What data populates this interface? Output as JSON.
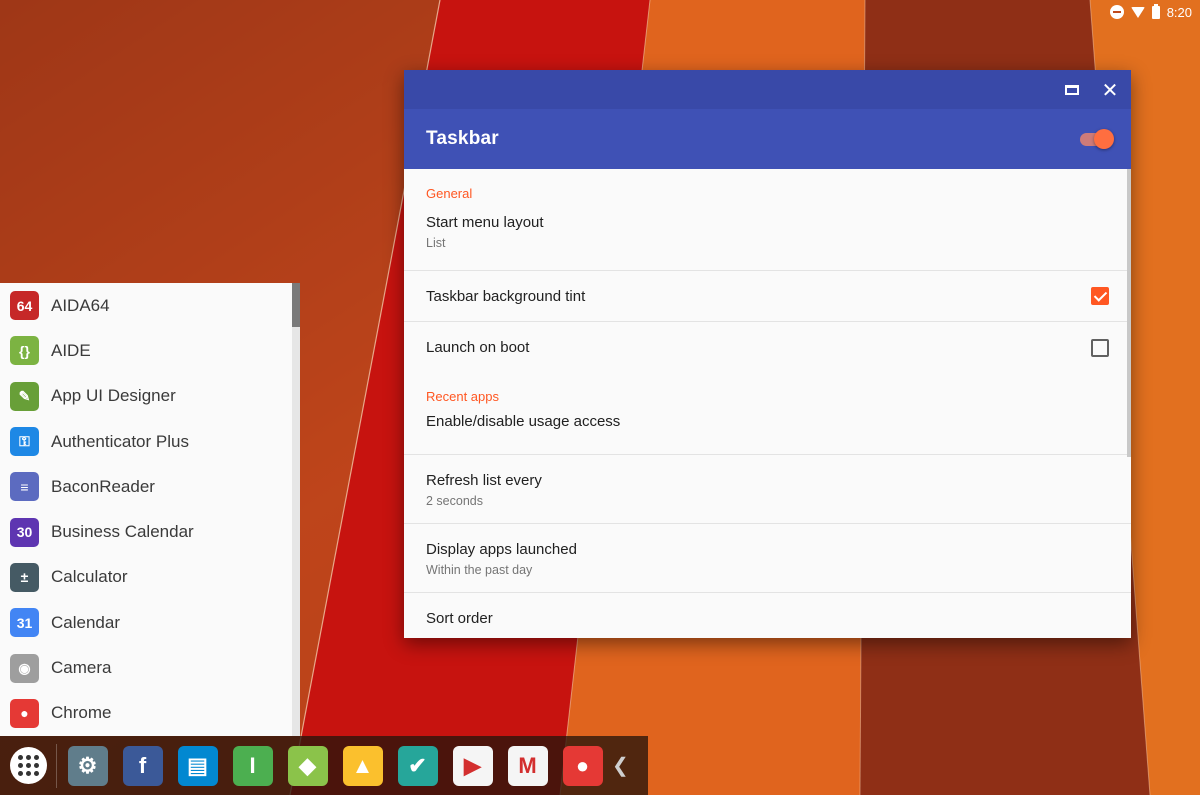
{
  "status_bar": {
    "time": "8:20",
    "icons": [
      "do-not-disturb-icon",
      "wifi-icon",
      "battery-icon"
    ]
  },
  "window": {
    "controls": [
      "restore-icon",
      "close-icon"
    ],
    "app_title": "Taskbar",
    "master_switch_on": true,
    "accent_color": "#ff5722",
    "header_color": "#3f51b5",
    "sections": {
      "general": {
        "header": "General",
        "start_menu_layout": {
          "title": "Start menu layout",
          "summary": "List"
        },
        "background_tint": {
          "title": "Taskbar background tint",
          "checked": true
        },
        "launch_on_boot": {
          "title": "Launch on boot",
          "checked": false
        }
      },
      "recent": {
        "header": "Recent apps",
        "usage_access": {
          "title": "Enable/disable usage access"
        },
        "refresh": {
          "title": "Refresh list every",
          "summary": "2 seconds"
        },
        "display_launched": {
          "title": "Display apps launched",
          "summary": "Within the past day"
        },
        "sort_order": {
          "title": "Sort order"
        }
      }
    }
  },
  "start_menu": {
    "apps": [
      {
        "label": "AIDA64",
        "icon": "aida64-icon",
        "glyph": "64",
        "color": "#c62828"
      },
      {
        "label": "AIDE",
        "icon": "aide-icon",
        "glyph": "{}",
        "color": "#7cb342"
      },
      {
        "label": "App UI Designer",
        "icon": "app-ui-designer-icon",
        "glyph": "✎",
        "color": "#689f38"
      },
      {
        "label": "Authenticator Plus",
        "icon": "authenticator-plus-icon",
        "glyph": "⚿",
        "color": "#1e88e5"
      },
      {
        "label": "BaconReader",
        "icon": "baconreader-icon",
        "glyph": "≡",
        "color": "#5c6bc0"
      },
      {
        "label": "Business Calendar",
        "icon": "business-calendar-icon",
        "glyph": "30",
        "color": "#5e35b1"
      },
      {
        "label": "Calculator",
        "icon": "calculator-icon",
        "glyph": "±",
        "color": "#455a64"
      },
      {
        "label": "Calendar",
        "icon": "calendar-icon",
        "glyph": "31",
        "color": "#4285f4"
      },
      {
        "label": "Camera",
        "icon": "camera-icon",
        "glyph": "◉",
        "color": "#9e9e9e"
      },
      {
        "label": "Chrome",
        "icon": "chrome-icon",
        "glyph": "●",
        "color": "#e53935"
      }
    ]
  },
  "taskbar": {
    "launcher_icon": "app-drawer-icon",
    "pinned": [
      {
        "icon": "settings-icon",
        "glyph": "⚙",
        "color": "#607d8b"
      },
      {
        "icon": "facebook-icon",
        "glyph": "f",
        "color": "#3b5998"
      },
      {
        "icon": "notes-icon",
        "glyph": "▤",
        "color": "#0288d1"
      },
      {
        "icon": "pushbullet-icon",
        "glyph": "I",
        "color": "#4caf50"
      },
      {
        "icon": "android-icon",
        "glyph": "◆",
        "color": "#8bc34a"
      },
      {
        "icon": "drive-icon",
        "glyph": "▲",
        "color": "#fbc02d"
      },
      {
        "icon": "tasks-check-icon",
        "glyph": "✔",
        "color": "#26a69a"
      },
      {
        "icon": "play-store-icon",
        "glyph": "▶",
        "color": "#f5f5f5"
      },
      {
        "icon": "gmail-icon",
        "glyph": "M",
        "color": "#f5f5f5"
      },
      {
        "icon": "chrome-icon",
        "glyph": "●",
        "color": "#e53935"
      }
    ],
    "overflow_icon": "chevron-left-icon"
  }
}
